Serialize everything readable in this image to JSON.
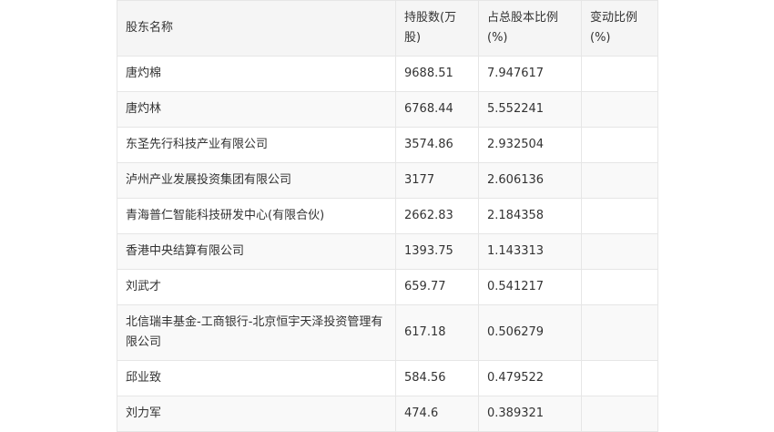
{
  "table": {
    "headers": [
      "股东名称",
      "持股数(万股)",
      "占总股本比例(%)",
      "变动比例(%)"
    ],
    "rows": [
      {
        "name": "唐灼棉",
        "shares": "9688.51",
        "ratio": "7.947617",
        "change": ""
      },
      {
        "name": "唐灼林",
        "shares": "6768.44",
        "ratio": "5.552241",
        "change": ""
      },
      {
        "name": "东圣先行科技产业有限公司",
        "shares": "3574.86",
        "ratio": "2.932504",
        "change": ""
      },
      {
        "name": "泸州产业发展投资集团有限公司",
        "shares": "3177",
        "ratio": "2.606136",
        "change": ""
      },
      {
        "name": "青海普仁智能科技研发中心(有限合伙)",
        "shares": "2662.83",
        "ratio": "2.184358",
        "change": ""
      },
      {
        "name": "香港中央结算有限公司",
        "shares": "1393.75",
        "ratio": "1.143313",
        "change": ""
      },
      {
        "name": "刘武才",
        "shares": "659.77",
        "ratio": "0.541217",
        "change": ""
      },
      {
        "name": "北信瑞丰基金-工商银行-北京恒宇天泽投资管理有限公司",
        "shares": "617.18",
        "ratio": "0.506279",
        "change": ""
      },
      {
        "name": "邱业致",
        "shares": "584.56",
        "ratio": "0.479522",
        "change": ""
      },
      {
        "name": "刘力军",
        "shares": "474.6",
        "ratio": "0.389321",
        "change": ""
      }
    ]
  }
}
